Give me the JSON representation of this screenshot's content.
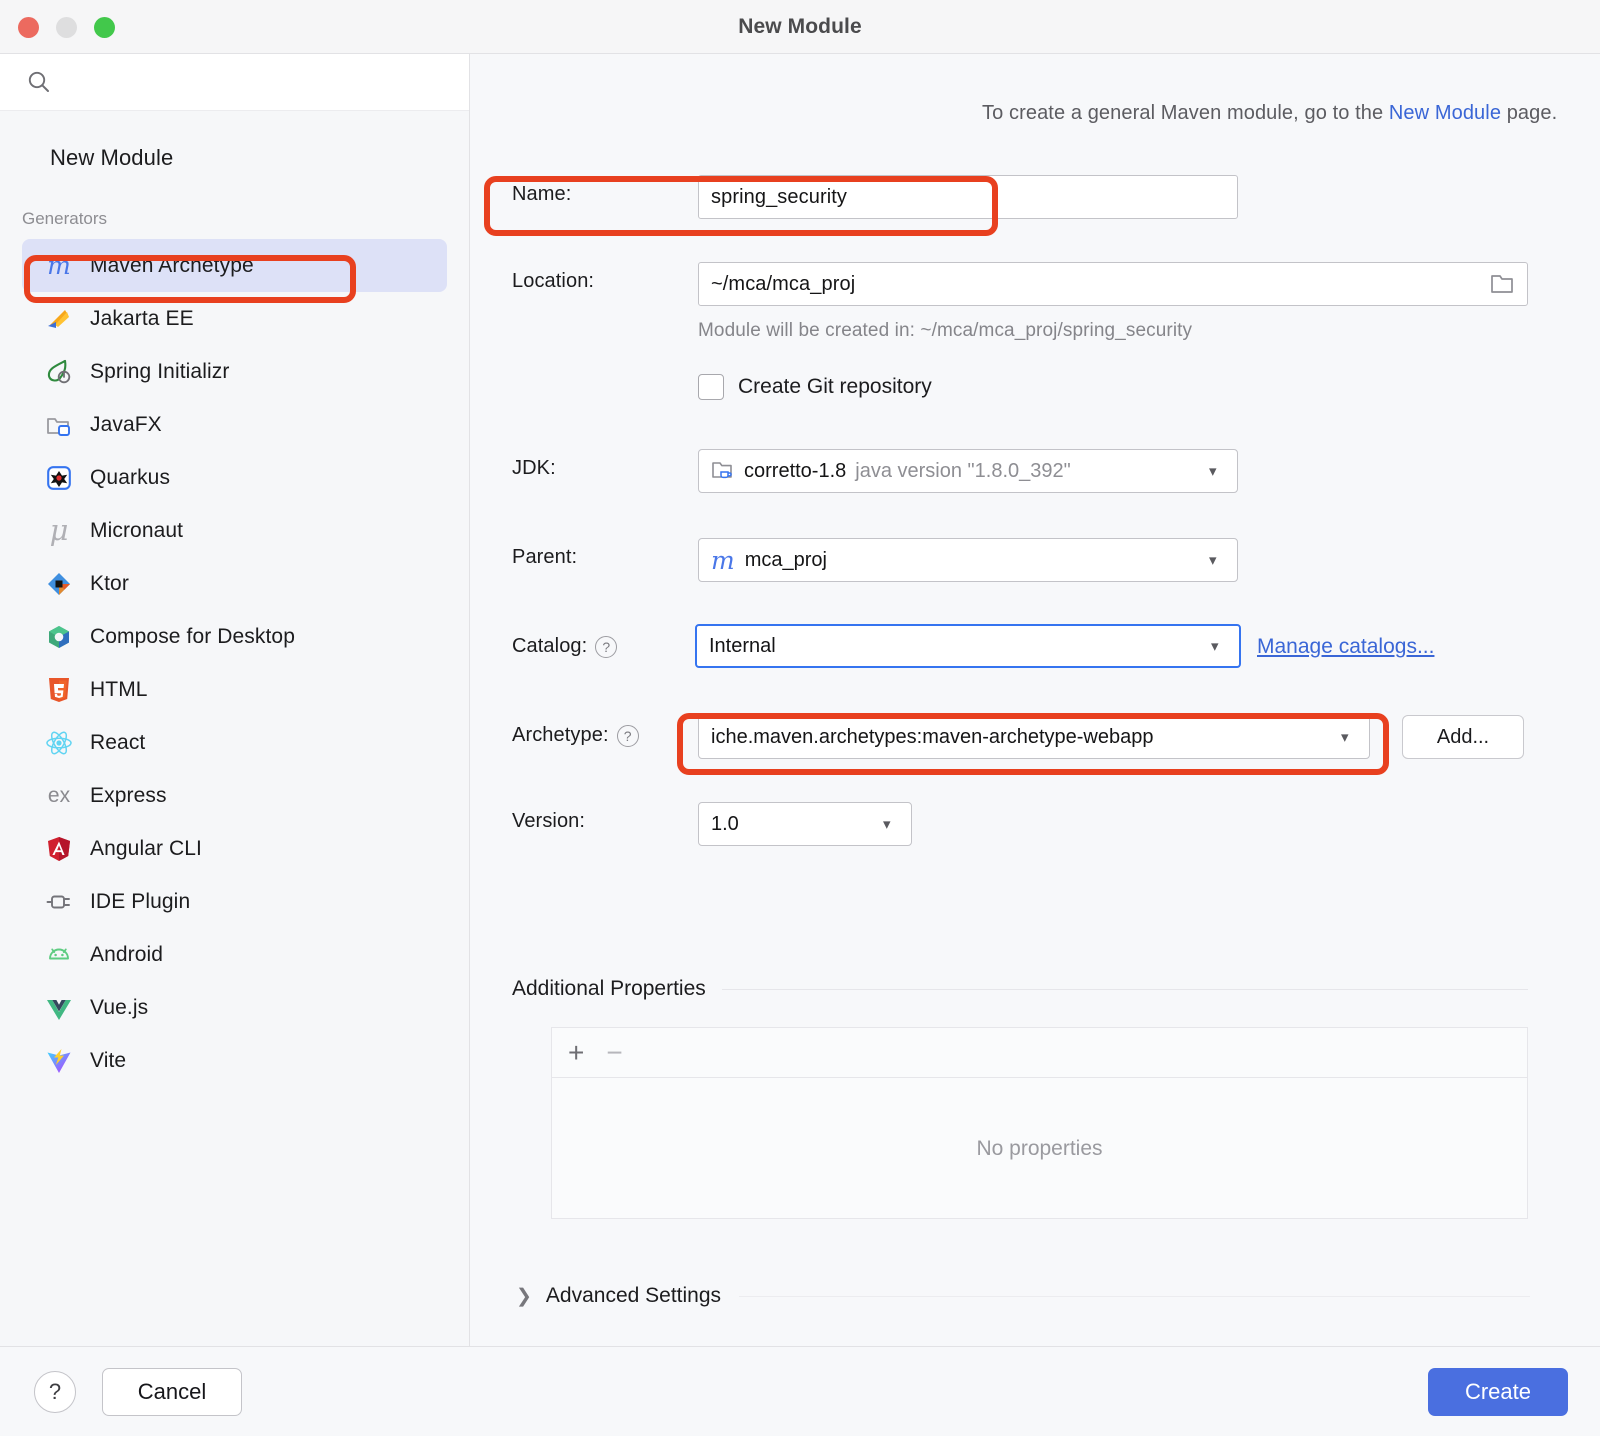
{
  "window": {
    "title": "New Module",
    "traffic_lights": [
      "close-red",
      "minimize-yellow",
      "zoom-green"
    ]
  },
  "sidebar": {
    "search": {
      "value": "",
      "placeholder": "",
      "icon": "search-icon"
    },
    "heading": "New Module",
    "group_label": "Generators",
    "items": [
      {
        "label": "Maven Archetype",
        "icon": "maven-icon",
        "selected": true
      },
      {
        "label": "Jakarta EE",
        "icon": "jakarta-ee-icon",
        "selected": false
      },
      {
        "label": "Spring Initializr",
        "icon": "spring-icon",
        "selected": false
      },
      {
        "label": "JavaFX",
        "icon": "javafx-icon",
        "selected": false
      },
      {
        "label": "Quarkus",
        "icon": "quarkus-icon",
        "selected": false
      },
      {
        "label": "Micronaut",
        "icon": "micronaut-icon",
        "selected": false
      },
      {
        "label": "Ktor",
        "icon": "ktor-icon",
        "selected": false
      },
      {
        "label": "Compose for Desktop",
        "icon": "compose-icon",
        "selected": false
      },
      {
        "label": "HTML",
        "icon": "html5-icon",
        "selected": false
      },
      {
        "label": "React",
        "icon": "react-icon",
        "selected": false
      },
      {
        "label": "Express",
        "icon": "express-icon",
        "selected": false
      },
      {
        "label": "Angular CLI",
        "icon": "angular-icon",
        "selected": false
      },
      {
        "label": "IDE Plugin",
        "icon": "plugin-icon",
        "selected": false
      },
      {
        "label": "Android",
        "icon": "android-icon",
        "selected": false
      },
      {
        "label": "Vue.js",
        "icon": "vuejs-icon",
        "selected": false
      },
      {
        "label": "Vite",
        "icon": "vite-icon",
        "selected": false
      }
    ]
  },
  "main": {
    "intro": {
      "prefix": "To create a general Maven module, go to the ",
      "link": "New Module",
      "suffix": " page."
    },
    "name": {
      "label": "Name:",
      "value": "spring_security"
    },
    "location": {
      "label": "Location:",
      "value": "~/mca/mca_proj",
      "browse_icon": "folder-icon",
      "note": "Module will be created in: ~/mca/mca_proj/spring_security"
    },
    "git": {
      "label": "Create Git repository",
      "checked": false
    },
    "jdk": {
      "label": "JDK:",
      "icon": "jdk-folder-icon",
      "value": "corretto-1.8",
      "detail": "java version \"1.8.0_392\"",
      "chevron": "chevron-down-icon"
    },
    "parent": {
      "label": "Parent:",
      "icon": "maven-icon",
      "value": "mca_proj",
      "chevron": "chevron-down-icon"
    },
    "catalog": {
      "label": "Catalog:",
      "help_icon": "question-icon",
      "value": "Internal",
      "chevron": "chevron-down-icon",
      "manage_link": "Manage catalogs..."
    },
    "archetype": {
      "label": "Archetype:",
      "help_icon": "question-icon",
      "value": "iche.maven.archetypes:maven-archetype-webapp",
      "chevron": "chevron-down-icon",
      "add_button": "Add..."
    },
    "version": {
      "label": "Version:",
      "value": "1.0",
      "chevron": "chevron-down-icon"
    },
    "additional_properties": {
      "section_title": "Additional Properties",
      "add_icon": "plus-icon",
      "remove_icon": "minus-icon",
      "empty_text": "No properties"
    },
    "advanced_settings": {
      "label": "Advanced Settings",
      "arrow_icon": "chevron-right-icon",
      "expanded": false
    }
  },
  "footer": {
    "help_icon": "question-icon",
    "help_label": "?",
    "cancel_label": "Cancel",
    "create_label": "Create"
  },
  "annotations": {
    "color": "#e8401f",
    "boxes": [
      "name-field-highlight",
      "maven-archetype-item-highlight",
      "archetype-field-highlight"
    ]
  },
  "colors": {
    "accent_blue": "#4a6fe0",
    "link_blue": "#3a66d6",
    "focus_blue": "#3574f0",
    "annotation_red": "#e8401f",
    "selection_bg": "#dde1f7",
    "panel_bg": "#f7f8fa"
  }
}
